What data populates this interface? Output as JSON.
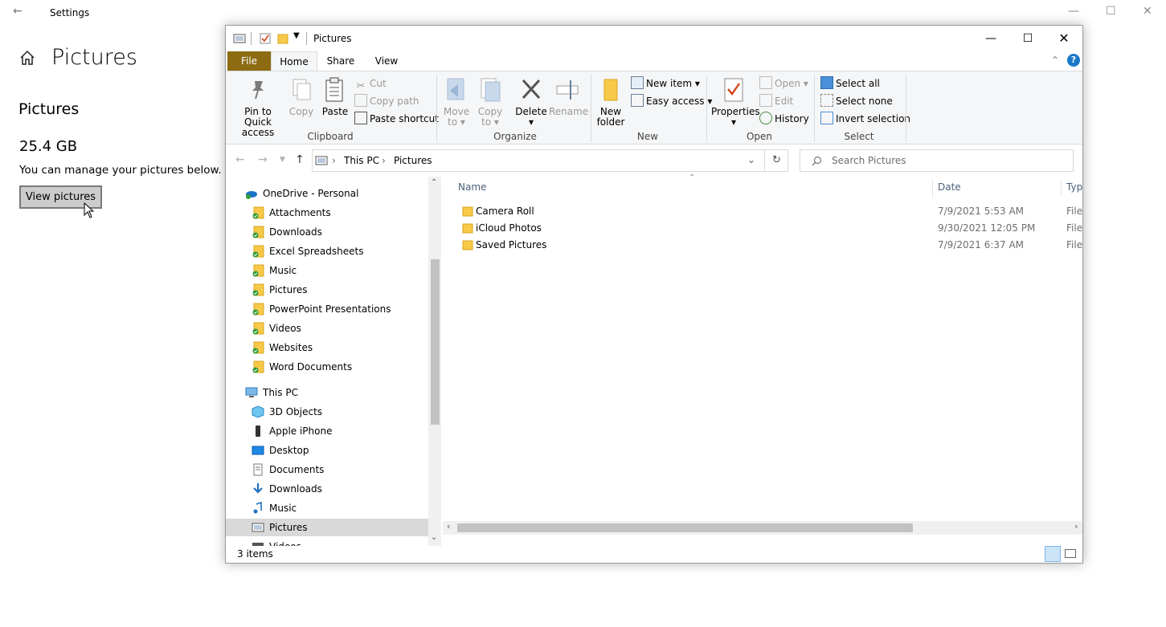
{
  "settings": {
    "window_title": "Settings",
    "heading": "Pictures",
    "section_title": "Pictures",
    "size": "25.4 GB",
    "description": "You can manage your pictures below.",
    "button_label": "View pictures"
  },
  "explorer": {
    "title": "Pictures",
    "tabs": [
      "File",
      "Home",
      "Share",
      "View"
    ],
    "ribbon": {
      "clipboard": {
        "label": "Clipboard",
        "pin": [
          "Pin to Quick",
          "access"
        ],
        "copy": "Copy",
        "paste": "Paste",
        "cut": "Cut",
        "copy_path": "Copy path",
        "paste_shortcut": "Paste shortcut"
      },
      "organize": {
        "label": "Organize",
        "move_to": [
          "Move",
          "to"
        ],
        "copy_to": [
          "Copy",
          "to"
        ],
        "delete": "Delete",
        "rename": "Rename"
      },
      "new": {
        "label": "New",
        "new_folder": [
          "New",
          "folder"
        ],
        "new_item": "New item",
        "easy_access": "Easy access"
      },
      "open": {
        "label": "Open",
        "properties": "Properties",
        "open": "Open",
        "edit": "Edit",
        "history": "History"
      },
      "select": {
        "label": "Select",
        "select_all": "Select all",
        "select_none": "Select none",
        "invert": "Invert selection"
      }
    },
    "address": {
      "crumbs": [
        "This PC",
        "Pictures"
      ],
      "search_placeholder": "Search Pictures"
    },
    "nav": {
      "onedrive": "OneDrive - Personal",
      "onedrive_items": [
        "Attachments",
        "Downloads",
        "Excel Spreadsheets",
        "Music",
        "Pictures",
        "PowerPoint Presentations",
        "Videos",
        "Websites",
        "Word Documents"
      ],
      "thispc": "This PC",
      "thispc_items": [
        "3D Objects",
        "Apple iPhone",
        "Desktop",
        "Documents",
        "Downloads",
        "Music",
        "Pictures",
        "Videos"
      ]
    },
    "columns": {
      "name": "Name",
      "date": "Date",
      "type": "Type"
    },
    "files": [
      {
        "name": "Camera Roll",
        "date": "7/9/2021 5:53 AM",
        "type": "File"
      },
      {
        "name": "iCloud Photos",
        "date": "9/30/2021 12:05 PM",
        "type": "File"
      },
      {
        "name": "Saved Pictures",
        "date": "7/9/2021 6:37 AM",
        "type": "File"
      }
    ],
    "status": "3 items",
    "colors": {
      "file_tab": "#8c6b13",
      "folder": "#f7c948",
      "accent": "#0078d7"
    }
  }
}
